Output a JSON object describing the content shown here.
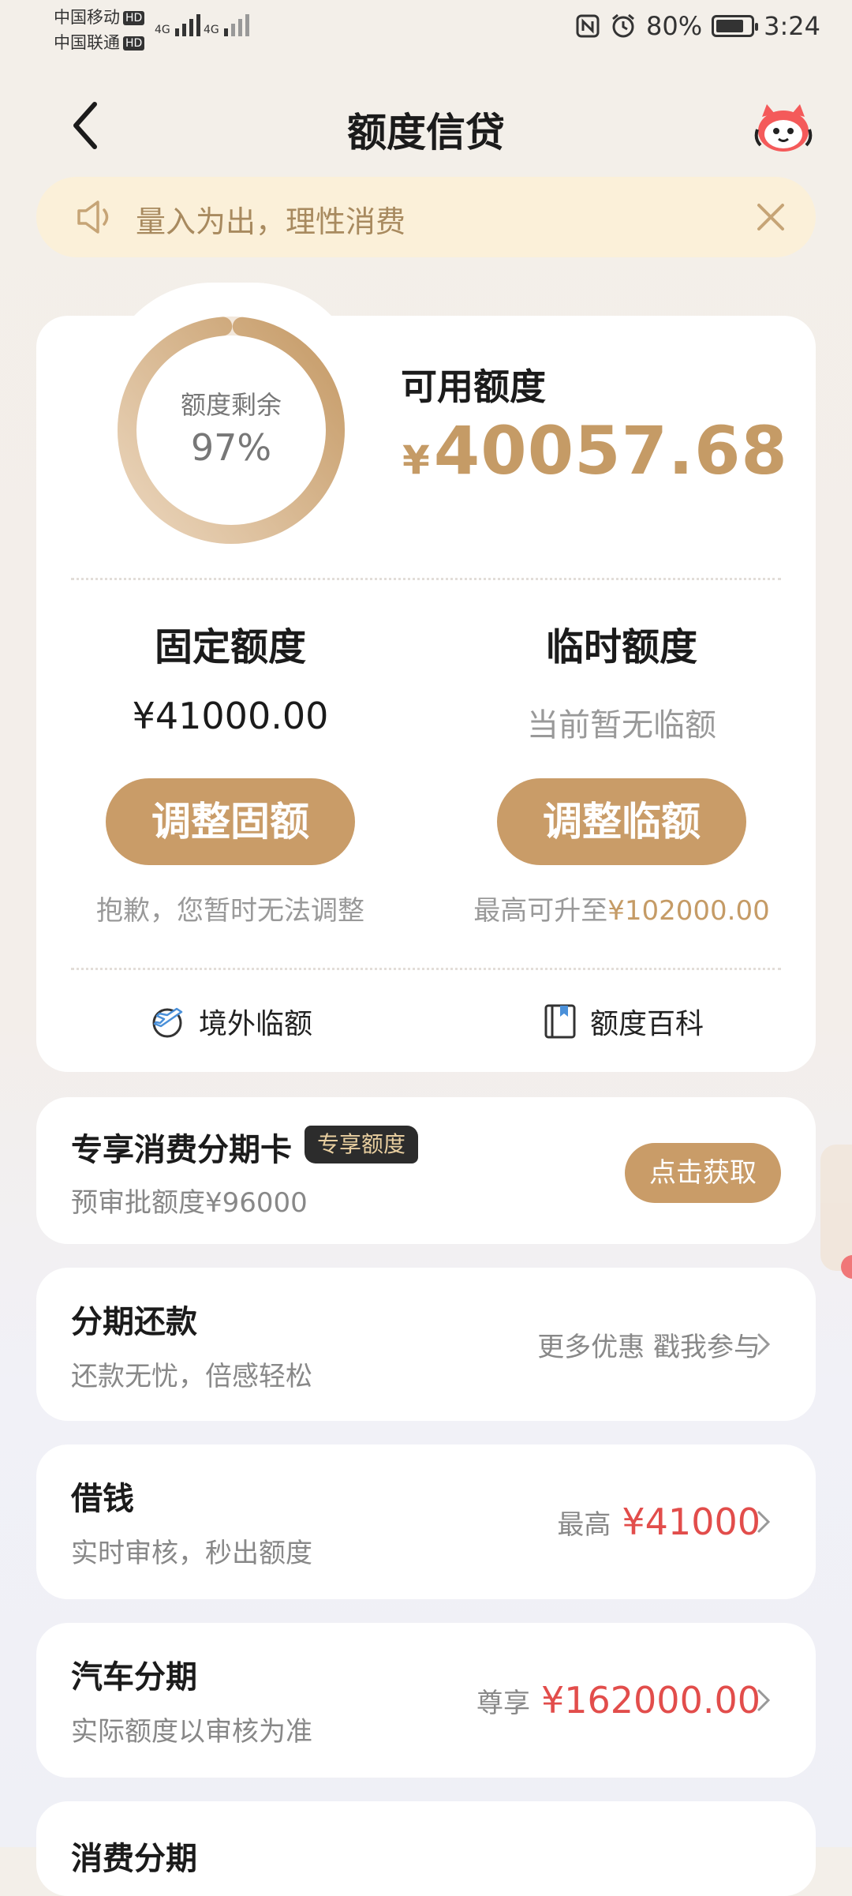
{
  "status_bar": {
    "carrier1": "中国移动",
    "carrier2": "中国联通",
    "hd": "HD",
    "net": "4G",
    "battery": "80%",
    "time": "3:24"
  },
  "header": {
    "title": "额度信贷"
  },
  "notice": {
    "text": "量入为出，理性消费"
  },
  "quota": {
    "ring_label": "额度剩余",
    "ring_value": "97%",
    "ring_percent": 97,
    "available_title": "可用额度",
    "currency": "¥",
    "available_amount": "40057.68",
    "fixed": {
      "title": "固定额度",
      "value": "¥41000.00",
      "button": "调整固额",
      "note": "抱歉，您暂时无法调整"
    },
    "temp": {
      "title": "临时额度",
      "value": "当前暂无临额",
      "button": "调整临额",
      "note_prefix": "最高可升至",
      "note_amount": "¥102000.00"
    },
    "links": {
      "overseas": "境外临额",
      "wiki": "额度百科"
    }
  },
  "exclusive_card": {
    "title": "专享消费分期卡",
    "badge": "专享额度",
    "sub": "预审批额度¥96000",
    "button": "点击获取"
  },
  "installment_repay": {
    "title": "分期还款",
    "sub": "还款无忧，倍感轻松",
    "right": "更多优惠 戳我参与"
  },
  "borrow": {
    "title": "借钱",
    "sub": "实时审核，秒出额度",
    "right_prefix": "最高",
    "right_amount": "¥41000"
  },
  "car_loan": {
    "title": "汽车分期",
    "sub": "实际额度以审核为准",
    "right_prefix": "尊享",
    "right_amount": "¥162000.00"
  },
  "consumer_installment": {
    "title": "消费分期"
  },
  "colors": {
    "accent": "#c99c68",
    "gold_text": "#c59b66",
    "red": "#e24d4b",
    "notice_bg": "#fbf0d9"
  }
}
